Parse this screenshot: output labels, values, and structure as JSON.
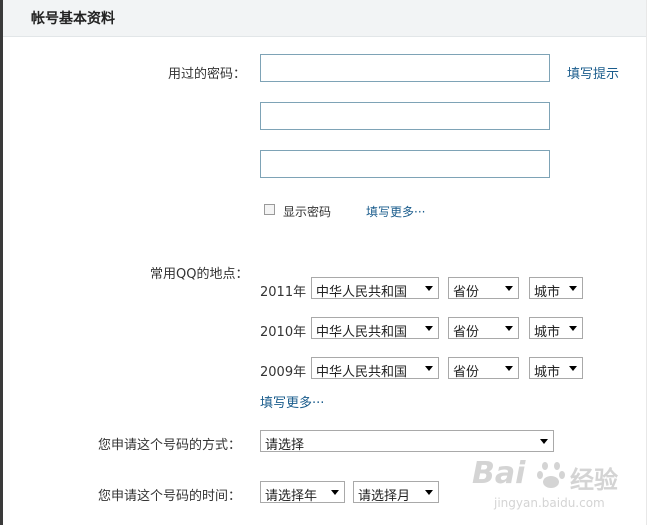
{
  "section": {
    "title": "帐号基本资料"
  },
  "password": {
    "label": "用过的密码：",
    "hint_link": "填写提示",
    "inputs": [
      "",
      "",
      ""
    ],
    "show_password_label": "显示密码",
    "more_link": "填写更多···"
  },
  "locations": {
    "label": "常用QQ的地点：",
    "rows": [
      {
        "year": "2011年",
        "country": "中华人民共和国",
        "province": "省份",
        "city": "城市"
      },
      {
        "year": "2010年",
        "country": "中华人民共和国",
        "province": "省份",
        "city": "城市"
      },
      {
        "year": "2009年",
        "country": "中华人民共和国",
        "province": "省份",
        "city": "城市"
      }
    ],
    "more_link": "填写更多···"
  },
  "apply_method": {
    "label": "您申请这个号码的方式：",
    "value": "请选择"
  },
  "apply_time": {
    "label": "您申请这个号码的时间：",
    "year_value": "请选择年",
    "month_value": "请选择月"
  },
  "watermark": {
    "brand": "Bai",
    "brand_cn": "经验",
    "url": "jingyan.baidu.com"
  }
}
